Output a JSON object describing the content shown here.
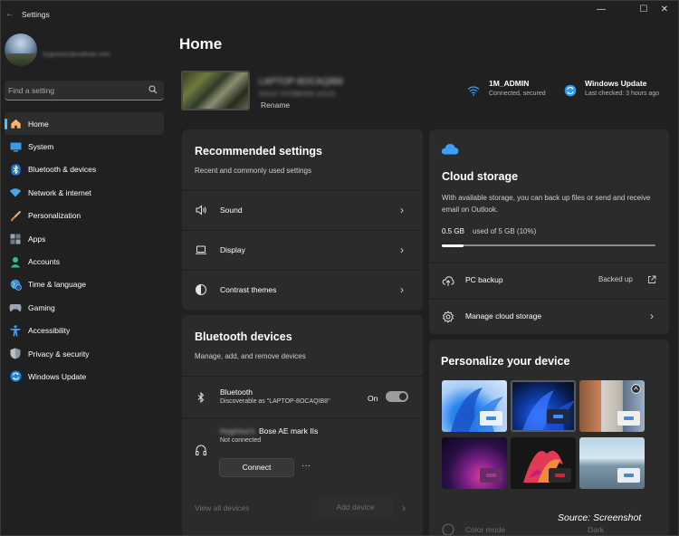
{
  "window": {
    "app_title": "Settings",
    "back_label": "←",
    "minimize": "—",
    "maximize": "☐",
    "close": "✕"
  },
  "account": {
    "email": "hyginiusn@outlook.com"
  },
  "search": {
    "placeholder": "Find a setting"
  },
  "sidebar": {
    "items": [
      {
        "label": "Home",
        "icon": "home-icon",
        "active": true
      },
      {
        "label": "System",
        "icon": "monitor-icon"
      },
      {
        "label": "Bluetooth & devices",
        "icon": "bluetooth-icon"
      },
      {
        "label": "Network & internet",
        "icon": "wifi-icon"
      },
      {
        "label": "Personalization",
        "icon": "brush-icon"
      },
      {
        "label": "Apps",
        "icon": "apps-icon"
      },
      {
        "label": "Accounts",
        "icon": "person-icon"
      },
      {
        "label": "Time & language",
        "icon": "globe-clock-icon"
      },
      {
        "label": "Gaming",
        "icon": "gamepad-icon"
      },
      {
        "label": "Accessibility",
        "icon": "accessibility-icon"
      },
      {
        "label": "Privacy & security",
        "icon": "shield-icon"
      },
      {
        "label": "Windows Update",
        "icon": "update-icon"
      }
    ]
  },
  "main": {
    "title": "Home",
    "pc": {
      "name": "LAPTOP-8OCAQIB8",
      "model": "ASUS VIVOBOOK ASUS",
      "rename_label": "Rename"
    },
    "network": {
      "title": "1M_ADMIN",
      "status": "Connected, secured"
    },
    "update": {
      "title": "Windows Update",
      "status": "Last checked: 3 hours ago"
    }
  },
  "recommended": {
    "title": "Recommended settings",
    "subtitle": "Recent and commonly used settings",
    "rows": [
      {
        "label": "Sound",
        "icon": "speaker-icon"
      },
      {
        "label": "Display",
        "icon": "laptop-icon"
      },
      {
        "label": "Contrast themes",
        "icon": "contrast-icon"
      }
    ]
  },
  "bluetooth": {
    "title": "Bluetooth devices",
    "subtitle": "Manage, add, and remove devices",
    "toggle_title": "Bluetooth",
    "toggle_sub": "Discoverable as \"LAPTOP-8OCAQIB8\"",
    "toggle_state": "On",
    "device_owner": "Hyginius's",
    "device_name": "Bose AE mark IIs",
    "device_status": "Not connected",
    "connect_label": "Connect",
    "more_label": "···",
    "view_all": "View all devices",
    "add_device": "Add device"
  },
  "cloud": {
    "title": "Cloud storage",
    "desc": "With available storage, you can back up files or send and receive email on Outlook.",
    "used": "0.5 GB",
    "of_total": "used of 5 GB (10%)",
    "progress_fraction": 0.1,
    "backup_label": "PC backup",
    "backup_status": "Backed up",
    "manage_label": "Manage cloud storage"
  },
  "personalize": {
    "title": "Personalize your device",
    "color_mode_label": "Color mode",
    "color_mode_value": "Dark",
    "wallpapers": [
      {
        "name": "bloom-light"
      },
      {
        "name": "bloom-dark"
      },
      {
        "name": "spotlight-collage"
      },
      {
        "name": "glow-purple"
      },
      {
        "name": "flow-red"
      },
      {
        "name": "lake"
      }
    ]
  },
  "watermark": "Source: Screenshot",
  "colors": {
    "background": "#202020",
    "card": "#2b2b2b",
    "accent": "#4cc2ff",
    "wifi_icon": "#3aa0ff",
    "update_icon": "#2b9af3"
  }
}
